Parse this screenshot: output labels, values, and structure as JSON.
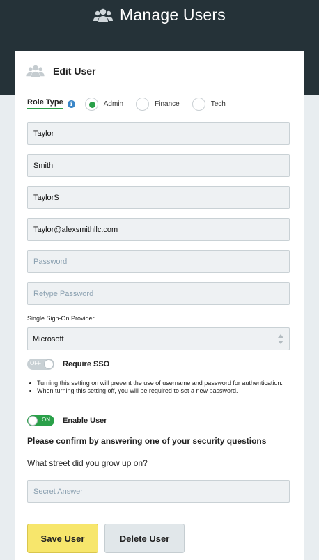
{
  "header": {
    "title": "Manage Users",
    "icon": "users-icon"
  },
  "card": {
    "title": "Edit User",
    "icon": "users-icon"
  },
  "role": {
    "label": "Role Type",
    "info_icon": "i",
    "selected": "Admin",
    "options": [
      "Admin",
      "Finance",
      "Tech"
    ]
  },
  "fields": {
    "first_name": "Taylor",
    "last_name": "Smith",
    "username": "TaylorS",
    "email": "Taylor@alexsmithllc.com",
    "password_placeholder": "Password",
    "retype_password_placeholder": "Retype Password",
    "secret_answer_placeholder": "Secret Answer"
  },
  "sso": {
    "label": "Single Sign-On Provider",
    "provider": "Microsoft",
    "require_label": "Require SSO",
    "require_state": "OFF",
    "notes": [
      "Turning this setting on will prevent the use of username and password for authentication.",
      "When turning this setting off, you will be required to set a new password."
    ]
  },
  "enable": {
    "label": "Enable User",
    "state": "ON"
  },
  "security": {
    "heading": "Please confirm by answering one of your security questions",
    "question": "What street did you grow up on?"
  },
  "buttons": {
    "save": "Save User",
    "delete": "Delete User"
  },
  "colors": {
    "header_bg": "#253238",
    "accent_green": "#2aa049",
    "save_yellow": "#f7e66c",
    "info_blue": "#3a86c8"
  }
}
